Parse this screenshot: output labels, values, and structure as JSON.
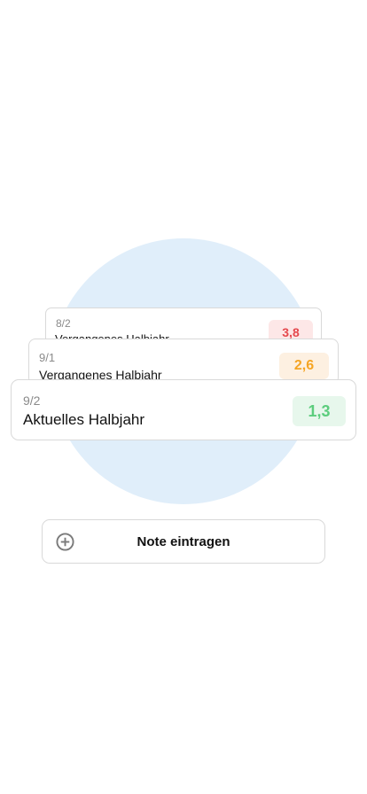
{
  "cards": [
    {
      "term": "8/2",
      "title": "Vergangenes Halbjahr",
      "grade": "3,8"
    },
    {
      "term": "9/1",
      "title": "Vergangenes Halbjahr",
      "grade": "2,6"
    },
    {
      "term": "9/2",
      "title": "Aktuelles Halbjahr",
      "grade": "1,3"
    }
  ],
  "grade_colors": {
    "bad": "#e5484d",
    "medium": "#f5a524",
    "good": "#5ccd7d"
  },
  "add_button": {
    "label": "Note eintragen",
    "icon": "plus-circle-icon"
  }
}
